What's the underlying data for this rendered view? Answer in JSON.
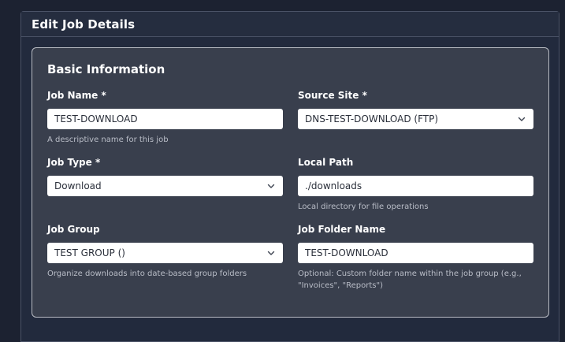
{
  "panel": {
    "title": "Edit Job Details"
  },
  "section": {
    "title": "Basic Information"
  },
  "fields": {
    "job_name": {
      "label": "Job Name *",
      "value": "TEST-DOWNLOAD",
      "help": "A descriptive name for this job"
    },
    "source_site": {
      "label": "Source Site *",
      "value": "DNS-TEST-DOWNLOAD (FTP)"
    },
    "job_type": {
      "label": "Job Type *",
      "value": "Download"
    },
    "local_path": {
      "label": "Local Path",
      "value": "./downloads",
      "help": "Local directory for file operations"
    },
    "job_group": {
      "label": "Job Group",
      "value": "TEST GROUP ()",
      "help": "Organize downloads into date-based group folders"
    },
    "job_folder_name": {
      "label": "Job Folder Name",
      "value": "TEST-DOWNLOAD",
      "help": "Optional: Custom folder name within the job group (e.g., \"Invoices\", \"Reports\")"
    }
  },
  "icons": {
    "select_arrow": "chevron-down-icon"
  },
  "colors": {
    "page_background": "#1c2231",
    "panel_background": "#222a3d",
    "card_background": "#393f4d",
    "card_border": "#b9bcc4",
    "input_background": "#ffffff"
  }
}
